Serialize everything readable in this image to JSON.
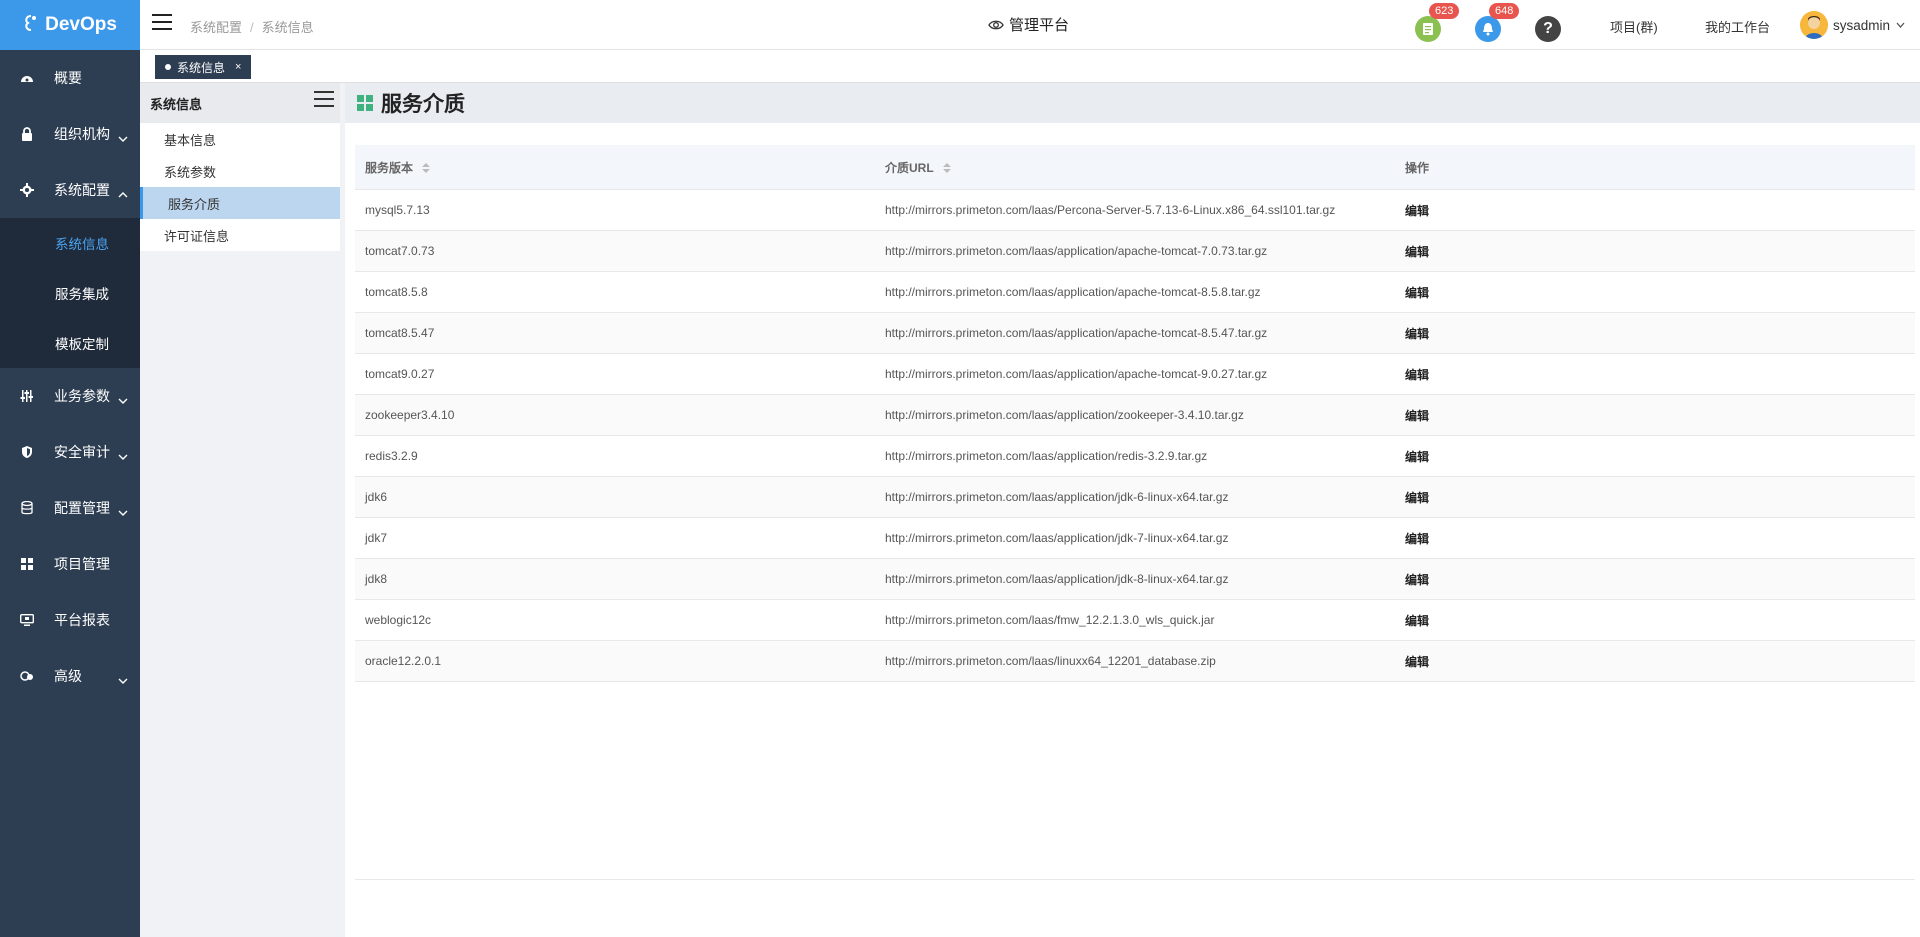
{
  "app": {
    "logo_text": "DevOps"
  },
  "sidebar": {
    "items": [
      {
        "label": "概要",
        "icon": "dashboard-icon",
        "has_chevron": false
      },
      {
        "label": "组织机构",
        "icon": "lock-icon",
        "has_chevron": true
      },
      {
        "label": "系统配置",
        "icon": "gear-icon",
        "has_chevron": true,
        "expanded": true
      },
      {
        "label": "业务参数",
        "icon": "sliders-icon",
        "has_chevron": true
      },
      {
        "label": "安全审计",
        "icon": "shield-icon",
        "has_chevron": true
      },
      {
        "label": "配置管理",
        "icon": "database-icon",
        "has_chevron": true
      },
      {
        "label": "项目管理",
        "icon": "grid-icon",
        "has_chevron": false
      },
      {
        "label": "平台报表",
        "icon": "monitor-icon",
        "has_chevron": false
      },
      {
        "label": "高级",
        "icon": "advanced-icon",
        "has_chevron": true
      }
    ],
    "subitems": [
      {
        "label": "系统信息",
        "active": true
      },
      {
        "label": "服务集成",
        "active": false
      },
      {
        "label": "模板定制",
        "active": false
      }
    ]
  },
  "header": {
    "breadcrumb": [
      "系统配置",
      "系统信息"
    ],
    "platform_label": "管理平台",
    "task_badge": "623",
    "bell_badge": "648",
    "project_group_link": "项目(群)",
    "workspace_link": "我的工作台",
    "username": "sysadmin"
  },
  "tabs": [
    {
      "label": "系统信息",
      "close": "×"
    }
  ],
  "submenu": {
    "title": "系统信息",
    "items": [
      {
        "label": "基本信息",
        "active": false
      },
      {
        "label": "系统参数",
        "active": false
      },
      {
        "label": "服务介质",
        "active": true
      },
      {
        "label": "许可证信息",
        "active": false
      }
    ]
  },
  "page": {
    "title": "服务介质"
  },
  "table": {
    "columns": [
      "服务版本",
      "介质URL",
      "操作"
    ],
    "edit_label": "编辑",
    "rows": [
      {
        "version": "mysql5.7.13",
        "url": "http://mirrors.primeton.com/laas/Percona-Server-5.7.13-6-Linux.x86_64.ssl101.tar.gz"
      },
      {
        "version": "tomcat7.0.73",
        "url": "http://mirrors.primeton.com/laas/application/apache-tomcat-7.0.73.tar.gz"
      },
      {
        "version": "tomcat8.5.8",
        "url": "http://mirrors.primeton.com/laas/application/apache-tomcat-8.5.8.tar.gz"
      },
      {
        "version": "tomcat8.5.47",
        "url": "http://mirrors.primeton.com/laas/application/apache-tomcat-8.5.47.tar.gz"
      },
      {
        "version": "tomcat9.0.27",
        "url": "http://mirrors.primeton.com/laas/application/apache-tomcat-9.0.27.tar.gz"
      },
      {
        "version": "zookeeper3.4.10",
        "url": "http://mirrors.primeton.com/laas/application/zookeeper-3.4.10.tar.gz"
      },
      {
        "version": "redis3.2.9",
        "url": "http://mirrors.primeton.com/laas/application/redis-3.2.9.tar.gz"
      },
      {
        "version": "jdk6",
        "url": "http://mirrors.primeton.com/laas/application/jdk-6-linux-x64.tar.gz"
      },
      {
        "version": "jdk7",
        "url": "http://mirrors.primeton.com/laas/application/jdk-7-linux-x64.tar.gz"
      },
      {
        "version": "jdk8",
        "url": "http://mirrors.primeton.com/laas/application/jdk-8-linux-x64.tar.gz"
      },
      {
        "version": "weblogic12c",
        "url": "http://mirrors.primeton.com/laas/fmw_12.2.1.3.0_wls_quick.jar"
      },
      {
        "version": "oracle12.2.0.1",
        "url": "http://mirrors.primeton.com/laas/linuxx64_12201_database.zip"
      }
    ]
  },
  "colors": {
    "sidebar_bg": "#2d3d52",
    "logo_bg": "#3c98e8",
    "accent": "#4aa3f2",
    "badge_red": "#e8554e",
    "task_green": "#8cc152",
    "bell_blue": "#3c98e8",
    "title_icon_green": "#3fb27f"
  }
}
